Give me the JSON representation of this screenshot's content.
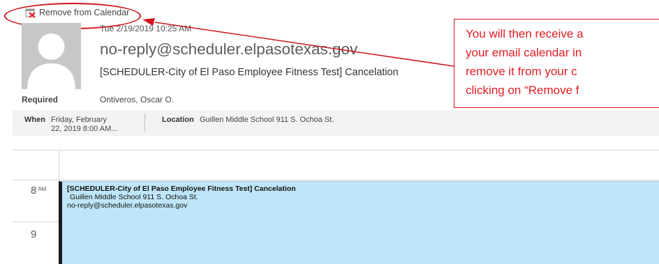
{
  "toolbar": {
    "remove_label": "Remove from Calendar",
    "remove_icon": "calendar-remove-icon"
  },
  "message": {
    "date": "Tue 2/19/2019 10:25 AM",
    "sender": "no-reply@scheduler.elpasotexas.gov",
    "subject": "[SCHEDULER-City of El Paso Employee Fitness Test] Cancelation",
    "required_label": "Required",
    "attendee": "Ontiveros, Oscar O."
  },
  "meeting": {
    "when_label": "When",
    "when_value_line1": "Friday, February",
    "when_value_line2": "22, 2019 8:00 AM...",
    "location_label": "Location",
    "location_value": "Guillen Middle School 911 S. Ochoa St."
  },
  "calendar": {
    "hour_8": "8",
    "hour_8_suffix": "AM",
    "hour_9": "9",
    "event": {
      "title": "[SCHEDULER-City of El Paso Employee Fitness Test] Cancelation",
      "location": "Guillen Middle School 911 S. Ochoa St.",
      "organizer": "no-reply@scheduler.elpasotexas.gov"
    }
  },
  "callout": {
    "line1": "You will then receive a",
    "line2": "your email calendar in",
    "line3": "remove it from your c",
    "line4": "clicking on “Remove f"
  },
  "colors": {
    "annotation_red": "#d0141d",
    "event_fill": "#bfe6f8",
    "avatar_gray": "#c7c7c7"
  }
}
